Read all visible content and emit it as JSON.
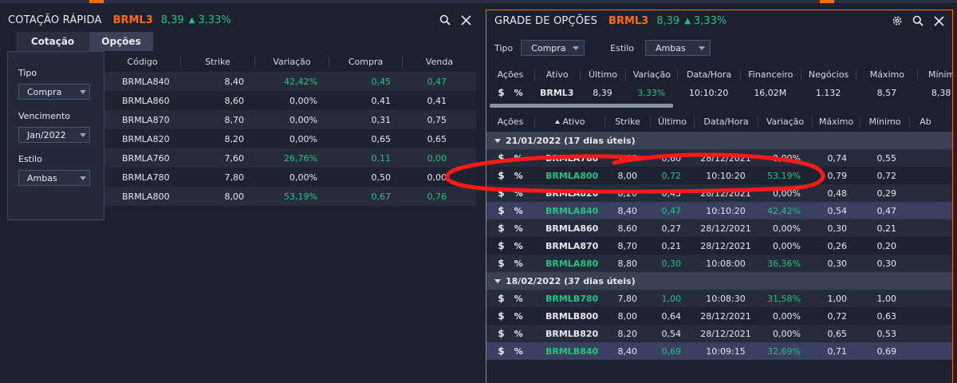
{
  "left_panel": {
    "title": "COTAÇÃO RÁPIDA",
    "ticker": "BRML3",
    "price": "8,39",
    "change": "3,33%",
    "tabs": [
      {
        "label": "Cotação"
      },
      {
        "label": "Opções"
      }
    ],
    "filters": {
      "tipo_label": "Tipo",
      "tipo_value": "Compra",
      "vencimento_label": "Vencimento",
      "vencimento_value": "Jan/2022",
      "estilo_label": "Estilo",
      "estilo_value": "Ambas"
    },
    "columns": [
      "Código",
      "Strike",
      "Variação",
      "Compra",
      "Venda"
    ],
    "rows": [
      {
        "codigo": "BRMLA840",
        "strike": "8,40",
        "variacao": "42,42%",
        "compra": "0,45",
        "venda": "0,47"
      },
      {
        "codigo": "BRMLA860",
        "strike": "8,60",
        "variacao": "0,00%",
        "compra": "0,41",
        "venda": "0,41"
      },
      {
        "codigo": "BRMLA870",
        "strike": "8,70",
        "variacao": "0,00%",
        "compra": "0,31",
        "venda": "0,75"
      },
      {
        "codigo": "BRMLA820",
        "strike": "8,20",
        "variacao": "0,00%",
        "compra": "0,65",
        "venda": "0,65"
      },
      {
        "codigo": "BRMLA760",
        "strike": "7,60",
        "variacao": "26,76%",
        "compra": "0,11",
        "venda": "0,00"
      },
      {
        "codigo": "BRMLA780",
        "strike": "7,80",
        "variacao": "0,00%",
        "compra": "0,50",
        "venda": "0,00"
      },
      {
        "codigo": "BRMLA800",
        "strike": "8,00",
        "variacao": "53,19%",
        "compra": "0,67",
        "venda": "0,76"
      }
    ]
  },
  "right_panel": {
    "title": "GRADE DE OPÇÕES",
    "ticker": "BRML3",
    "price": "8,39",
    "change": "3,33%",
    "tipo_label": "Tipo",
    "tipo_value": "Compra",
    "estilo_label": "Estilo",
    "estilo_value": "Ambas",
    "summary_columns": [
      "Ações",
      "Ativo",
      "Último",
      "Variação",
      "Data/Hora",
      "Financeiro",
      "Negócios",
      "Máximo",
      "Mínim"
    ],
    "summary_row": {
      "ativo": "BRML3",
      "ultimo": "8,39",
      "variacao": "3,33%",
      "datahora": "10:10:20",
      "financeiro": "16,02M",
      "negocios": "1.132",
      "maximo": "8,57",
      "minimo": "8,38"
    },
    "grid_columns": [
      "Ações",
      "Ativo",
      "Strike",
      "Último",
      "Data/Hora",
      "Variação",
      "Máximo",
      "Mínimo",
      "Ab"
    ],
    "groups": [
      {
        "label": "21/01/2022 (17 dias úteis)",
        "rows": [
          {
            "ativo": "BRMLA780",
            "strike": "7,80",
            "ultimo": "0,60",
            "datahora": "28/12/2021",
            "variacao": "0,00%",
            "maximo": "0,74",
            "minimo": "0,55"
          },
          {
            "ativo": "BRMLA800",
            "strike": "8,00",
            "ultimo": "0,72",
            "datahora": "10:10:20",
            "variacao": "53,19%",
            "maximo": "0,79",
            "minimo": "0,72"
          },
          {
            "ativo": "BRMLA820",
            "strike": "8,20",
            "ultimo": "0,43",
            "datahora": "28/12/2021",
            "variacao": "0,00%",
            "maximo": "0,48",
            "minimo": "0,29"
          },
          {
            "ativo": "BRMLA840",
            "strike": "8,40",
            "ultimo": "0,47",
            "datahora": "10:10:20",
            "variacao": "42,42%",
            "maximo": "0,54",
            "minimo": "0,47"
          },
          {
            "ativo": "BRMLA860",
            "strike": "8,60",
            "ultimo": "0,27",
            "datahora": "28/12/2021",
            "variacao": "0,00%",
            "maximo": "0,30",
            "minimo": "0,21"
          },
          {
            "ativo": "BRMLA870",
            "strike": "8,70",
            "ultimo": "0,21",
            "datahora": "28/12/2021",
            "variacao": "0,00%",
            "maximo": "0,26",
            "minimo": "0,20"
          },
          {
            "ativo": "BRMLA880",
            "strike": "8,80",
            "ultimo": "0,30",
            "datahora": "10:08:00",
            "variacao": "36,36%",
            "maximo": "0,30",
            "minimo": "0,30"
          }
        ]
      },
      {
        "label": "18/02/2022 (37 dias úteis)",
        "rows": [
          {
            "ativo": "BRMLB780",
            "strike": "7,80",
            "ultimo": "1,00",
            "datahora": "10:08:30",
            "variacao": "31,58%",
            "maximo": "1,00",
            "minimo": "1,00"
          },
          {
            "ativo": "BRMLB800",
            "strike": "8,00",
            "ultimo": "0,64",
            "datahora": "28/12/2021",
            "variacao": "0,00%",
            "maximo": "0,72",
            "minimo": "0,63"
          },
          {
            "ativo": "BRMLB820",
            "strike": "8,20",
            "ultimo": "0,54",
            "datahora": "28/12/2021",
            "variacao": "0,00%",
            "maximo": "0,65",
            "minimo": "0,53"
          },
          {
            "ativo": "BRMLB840",
            "strike": "8,40",
            "ultimo": "0,69",
            "datahora": "10:09:15",
            "variacao": "32,69%",
            "maximo": "0,71",
            "minimo": "0,69"
          }
        ]
      }
    ],
    "actions": {
      "dollar": "$",
      "percent": "%"
    }
  },
  "colors": {
    "accent": "#ff6a13",
    "positive": "#26c281",
    "annotation": "#ff1a1a",
    "highlight_row": "#3a4060"
  }
}
